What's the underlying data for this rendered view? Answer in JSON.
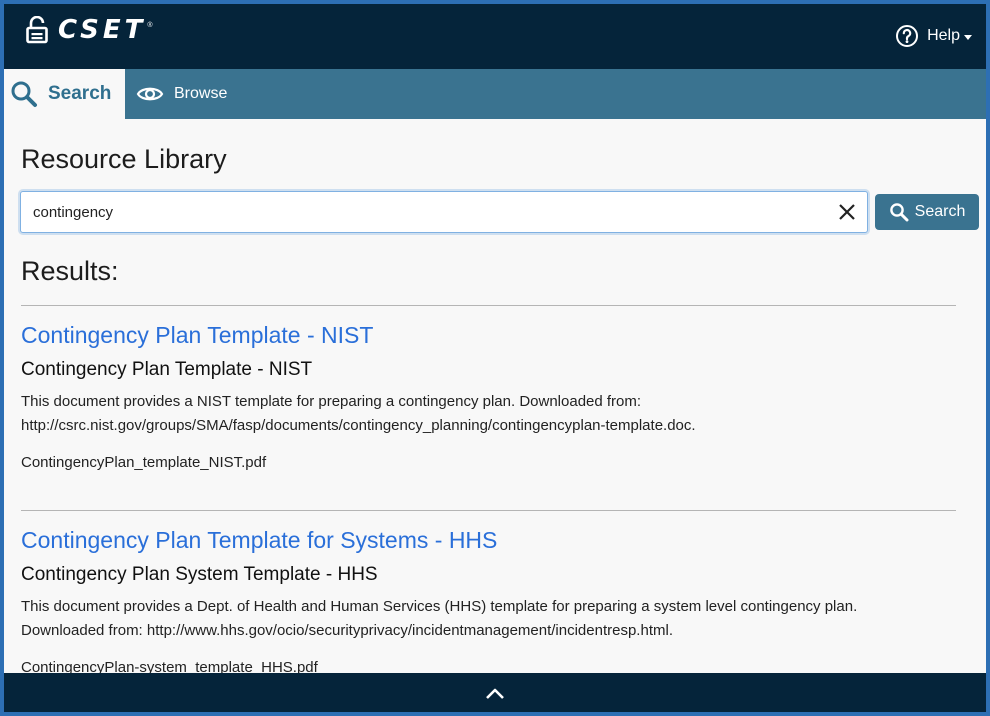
{
  "header": {
    "app_name": "CSET",
    "registered_mark": "®",
    "help_label": "Help"
  },
  "tabs": [
    {
      "label": "Search",
      "icon": "search-icon",
      "active": true
    },
    {
      "label": "Browse",
      "icon": "eye-icon",
      "active": false
    }
  ],
  "main": {
    "title": "Resource Library",
    "search": {
      "value": "contingency",
      "button_label": "Search"
    },
    "results_heading": "Results:",
    "results": [
      {
        "title": "Contingency Plan Template - NIST",
        "subtitle": "Contingency Plan Template - NIST",
        "description_line1": "This document provides a NIST template for preparing a contingency plan. Downloaded from:",
        "description_line2": "http://csrc.nist.gov/groups/SMA/fasp/documents/contingency_planning/contingencyplan-template.doc.",
        "file": "ContingencyPlan_template_NIST.pdf"
      },
      {
        "title": "Contingency Plan Template for Systems - HHS",
        "subtitle": "Contingency Plan System Template - HHS",
        "description_line1": "This document provides a Dept. of Health and Human Services (HHS) template for preparing a system level contingency plan.",
        "description_line2": "Downloaded from: http://www.hhs.gov/ocio/securityprivacy/incidentmanagement/incidentresp.html.",
        "file": "ContingencyPlan-system_template_HHS.pdf"
      }
    ]
  },
  "colors": {
    "header_bg": "#05243a",
    "tab_bar_bg": "#3a7390",
    "link": "#2a6fd9",
    "outer_border": "#2d6fb4"
  }
}
